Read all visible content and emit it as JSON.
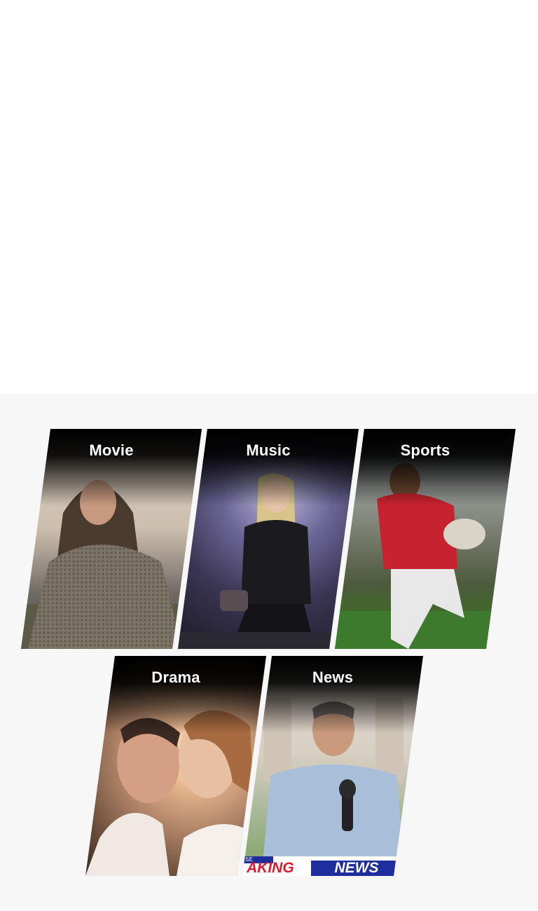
{
  "genres": [
    {
      "label": "Movie"
    },
    {
      "label": "Music"
    },
    {
      "label": "Sports"
    },
    {
      "label": "Drama"
    },
    {
      "label": "News"
    }
  ],
  "news_ticker": {
    "prefix": "SE",
    "left_text": "AKING",
    "right_text": "NEWS"
  },
  "colors": {
    "section_background": "#f7f7f7",
    "ticker_red": "#e01b2e",
    "ticker_blue": "#1e2e9c"
  }
}
